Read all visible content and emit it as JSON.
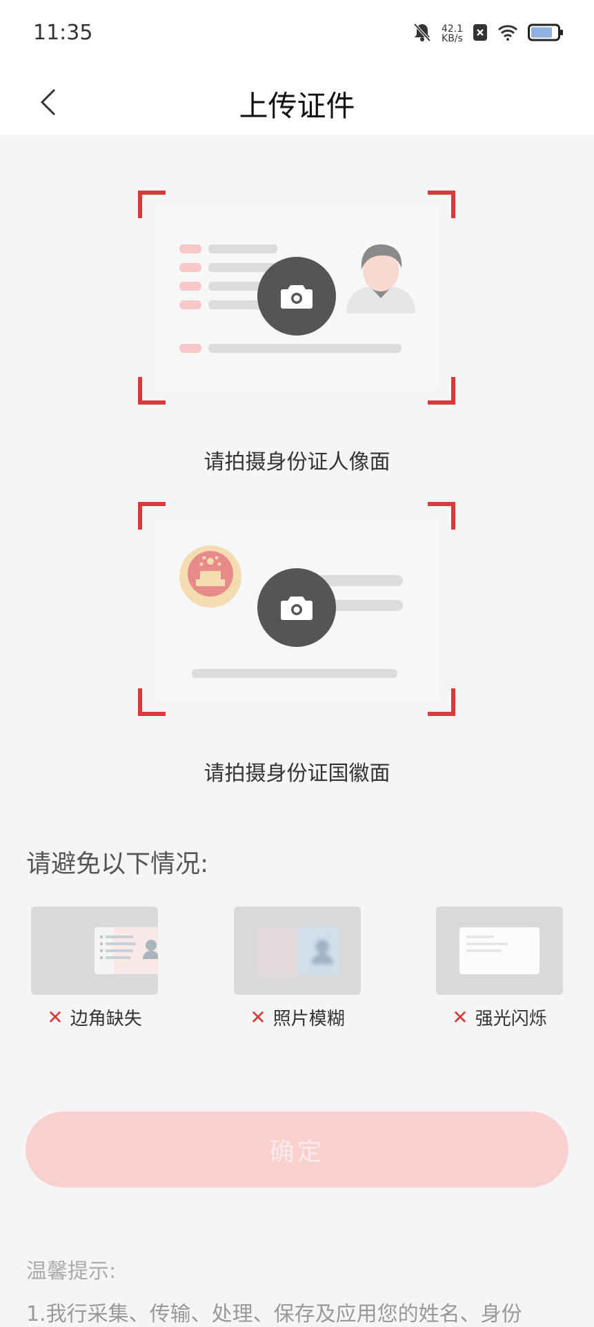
{
  "status_bar": {
    "time": "11:35",
    "net_speed_value": "42.1",
    "net_speed_unit": "KB/s",
    "battery_level": 0.7
  },
  "nav": {
    "title": "上传证件"
  },
  "cards": [
    {
      "label": "请拍摄身份证人像面"
    },
    {
      "label": "请拍摄身份证国徽面"
    }
  ],
  "avoid": {
    "title": "请避免以下情况:",
    "items": [
      {
        "label": "边角缺失"
      },
      {
        "label": "照片模糊"
      },
      {
        "label": "强光闪烁"
      }
    ]
  },
  "confirm_button": "确定",
  "tips": {
    "title": "温馨提示:",
    "line1": "1.我行采集、传输、处理、保存及应用您的姓名、身份"
  },
  "colors": {
    "accent": "#d63a3a",
    "button_disabled": "#f8d0d0"
  }
}
